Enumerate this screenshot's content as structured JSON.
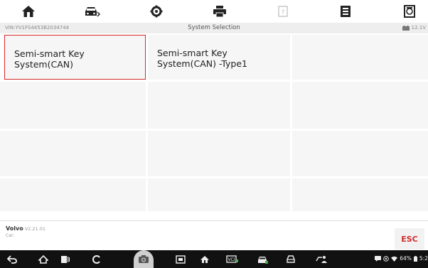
{
  "toolbar": {
    "icons": [
      "home-icon",
      "vehicle-swap-icon",
      "settings-icon",
      "print-icon",
      "help-icon",
      "data-save-icon",
      "report-icon"
    ]
  },
  "infobar": {
    "vin": "VIN:YV1FS4453B2034744",
    "title": "System Selection",
    "voltage": "12.1V"
  },
  "systems": [
    {
      "label_line1": "Semi-smart Key",
      "label_line2": "System(CAN)"
    },
    {
      "label_line1": "Semi-smart Key",
      "label_line2": "System(CAN) -Type1"
    }
  ],
  "footer": {
    "brand": "Volvo",
    "version": "V2.21.01",
    "car_label": "Car:",
    "esc_label": "ESC"
  },
  "status": {
    "battery": "64%",
    "time": "5:2"
  },
  "colors": {
    "accent_red": "#d12b2b",
    "cell_bg": "#f6f6f6",
    "infobar_bg": "#eeeeee",
    "navbar_bg": "#111111"
  }
}
